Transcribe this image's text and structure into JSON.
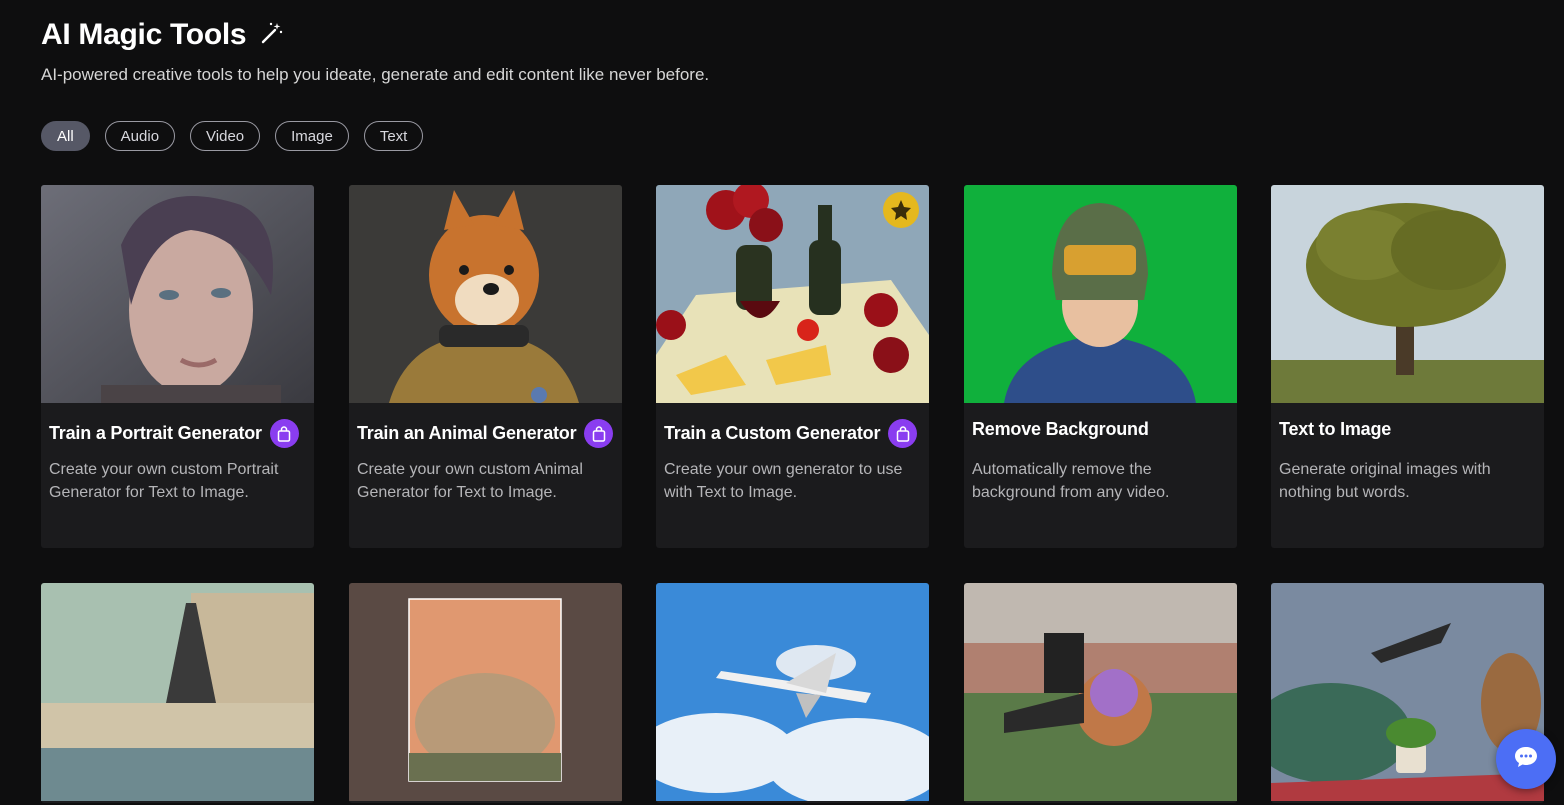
{
  "header": {
    "title": "AI Magic Tools",
    "subtitle": "AI-powered creative tools to help you ideate, generate and edit content like never before."
  },
  "filters": [
    "All",
    "Audio",
    "Video",
    "Image",
    "Text"
  ],
  "active_filter": "All",
  "cards": [
    {
      "title": "Train a Portrait Generator",
      "description": "Create your own custom Portrait Generator for Text to Image.",
      "badge": "shopping-bag-icon"
    },
    {
      "title": "Train an Animal Generator",
      "description": "Create your own custom Animal Generator for Text to Image.",
      "badge": "shopping-bag-icon"
    },
    {
      "title": "Train a Custom Generator",
      "description": "Create your own generator to use with Text to Image.",
      "badge": "shopping-bag-icon",
      "thumbnail_badge": "star-icon"
    },
    {
      "title": "Remove Background",
      "description": "Automatically remove the background from any video."
    },
    {
      "title": "Text to Image",
      "description": "Generate original images with nothing but words."
    }
  ],
  "colors": {
    "background": "#0e0e0f",
    "card": "#1b1b1d",
    "badge_purple": "#8a3df0",
    "chat_button": "#4c6ef5",
    "star_badge": "#e5b81e"
  }
}
